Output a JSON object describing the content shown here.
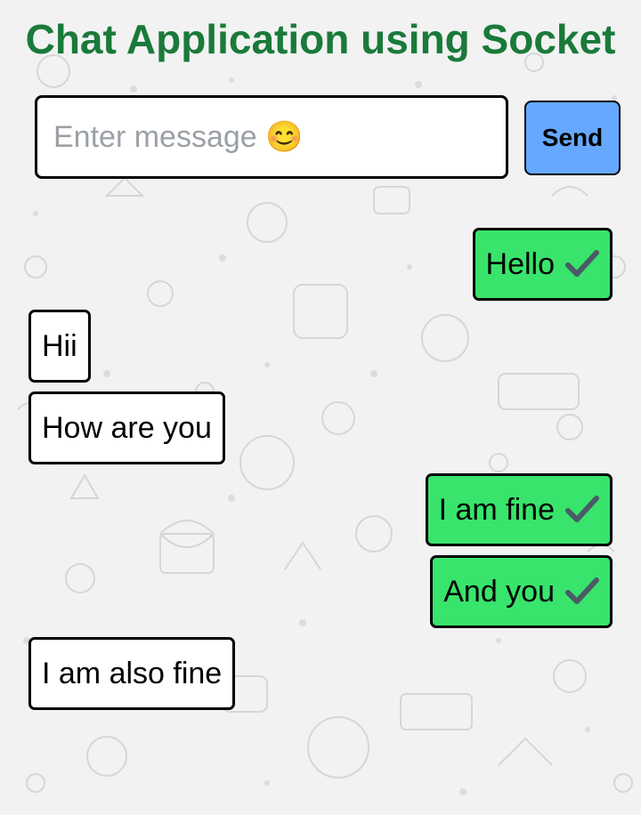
{
  "app": {
    "title": "Chat Application using Socket"
  },
  "composer": {
    "placeholder": "Enter message 😊",
    "value": "",
    "send_label": "Send"
  },
  "messages": [
    {
      "text": "Hello",
      "direction": "sent",
      "status_icon": "check-mark-icon"
    },
    {
      "text": "Hii",
      "direction": "received"
    },
    {
      "text": "How are you",
      "direction": "received"
    },
    {
      "text": "I am fine",
      "direction": "sent",
      "status_icon": "check-mark-icon"
    },
    {
      "text": "And you",
      "direction": "sent",
      "status_icon": "check-mark-icon"
    },
    {
      "text": "I am also fine",
      "direction": "received"
    }
  ],
  "colors": {
    "title": "#1a7a3a",
    "sent_bubble": "#38e46c",
    "received_bubble": "#ffffff",
    "send_button": "#66a8ff",
    "background": "#f2f2f2"
  }
}
